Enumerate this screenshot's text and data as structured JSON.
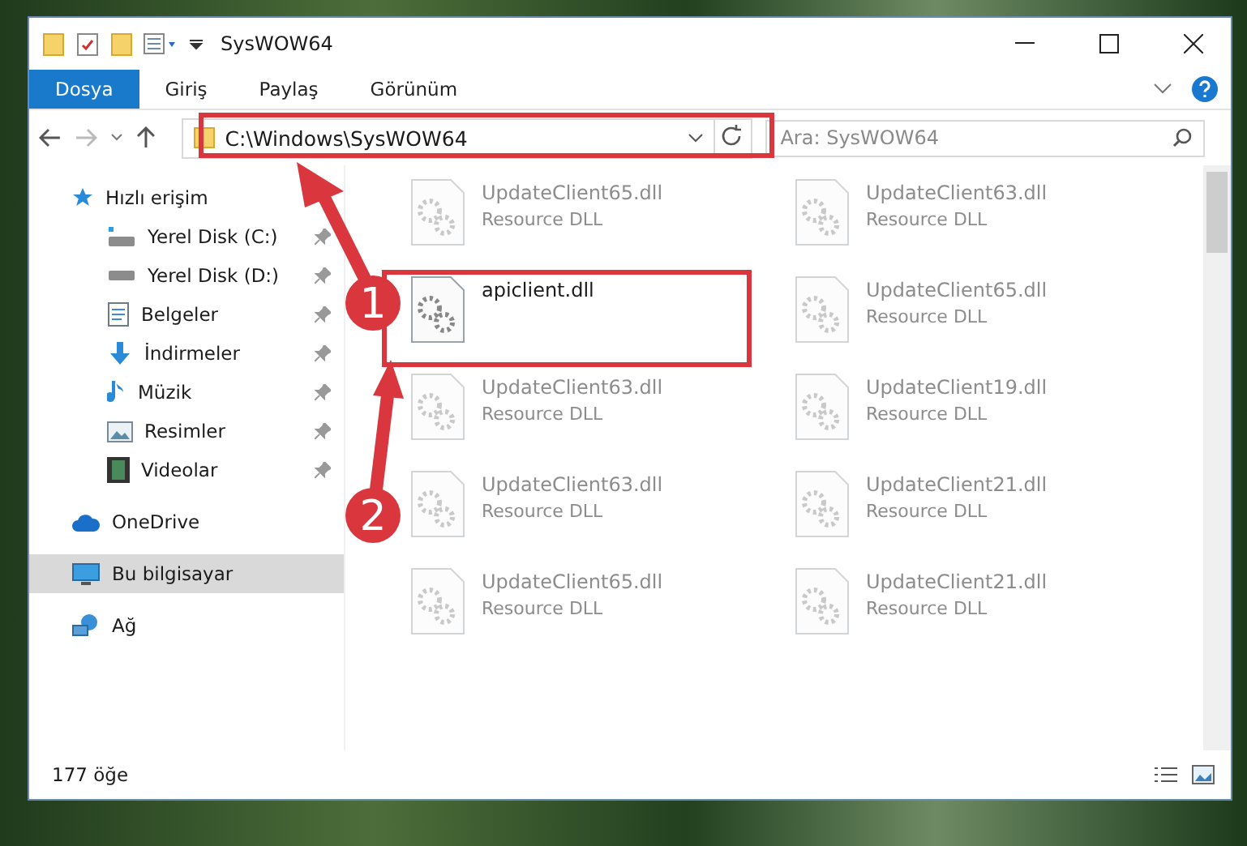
{
  "window": {
    "title": "SysWOW64"
  },
  "ribbon_tabs": [
    {
      "label": "Dosya",
      "selected": true
    },
    {
      "label": "Giriş",
      "selected": false
    },
    {
      "label": "Paylaş",
      "selected": false
    },
    {
      "label": "Görünüm",
      "selected": false
    }
  ],
  "address_bar": {
    "value": "C:\\Windows\\SysWOW64"
  },
  "search": {
    "placeholder": "Ara: SysWOW64"
  },
  "sidebar": {
    "items": [
      {
        "label": "Hızlı erişim",
        "kind": "star",
        "selected": false,
        "children": [
          {
            "label": "Yerel Disk (C:)",
            "kind": "drive-c",
            "pinned": true,
            "selected": false
          },
          {
            "label": "Yerel Disk (D:)",
            "kind": "drive",
            "pinned": true,
            "selected": false
          },
          {
            "label": "Belgeler",
            "kind": "docs",
            "pinned": true,
            "selected": false
          },
          {
            "label": "İndirmeler",
            "kind": "download",
            "pinned": true,
            "selected": false
          },
          {
            "label": "Müzik",
            "kind": "music",
            "pinned": true,
            "selected": false
          },
          {
            "label": "Resimler",
            "kind": "pictures",
            "pinned": true,
            "selected": false
          },
          {
            "label": "Videolar",
            "kind": "videos",
            "pinned": true,
            "selected": false
          }
        ]
      },
      {
        "label": "OneDrive",
        "kind": "cloud",
        "selected": false
      },
      {
        "label": "Bu bilgisayar",
        "kind": "computer",
        "selected": true
      },
      {
        "label": "Ağ",
        "kind": "network",
        "selected": false
      }
    ]
  },
  "files": [
    {
      "name": "UpdateClient65.dll",
      "type": "Resource DLL",
      "faded": true
    },
    {
      "name": "UpdateClient63.dll",
      "type": "Resource DLL",
      "faded": true
    },
    {
      "name": "apiclient.dll",
      "faded": false
    },
    {
      "name": "UpdateClient65.dll",
      "type": "Resource DLL",
      "faded": true
    },
    {
      "name": "UpdateClient63.dll",
      "type": "Resource DLL",
      "faded": true
    },
    {
      "name": "UpdateClient19.dll",
      "type": "Resource DLL",
      "faded": true
    },
    {
      "name": "UpdateClient63.dll",
      "type": "Resource DLL",
      "faded": true
    },
    {
      "name": "UpdateClient21.dll",
      "type": "Resource DLL",
      "faded": true
    },
    {
      "name": "UpdateClient65.dll",
      "type": "Resource DLL",
      "faded": true
    },
    {
      "name": "UpdateClient21.dll",
      "type": "Resource DLL",
      "faded": true
    }
  ],
  "status_bar": {
    "count": "177 öğe"
  },
  "annotations": [
    {
      "number": "1"
    },
    {
      "number": "2"
    }
  ]
}
